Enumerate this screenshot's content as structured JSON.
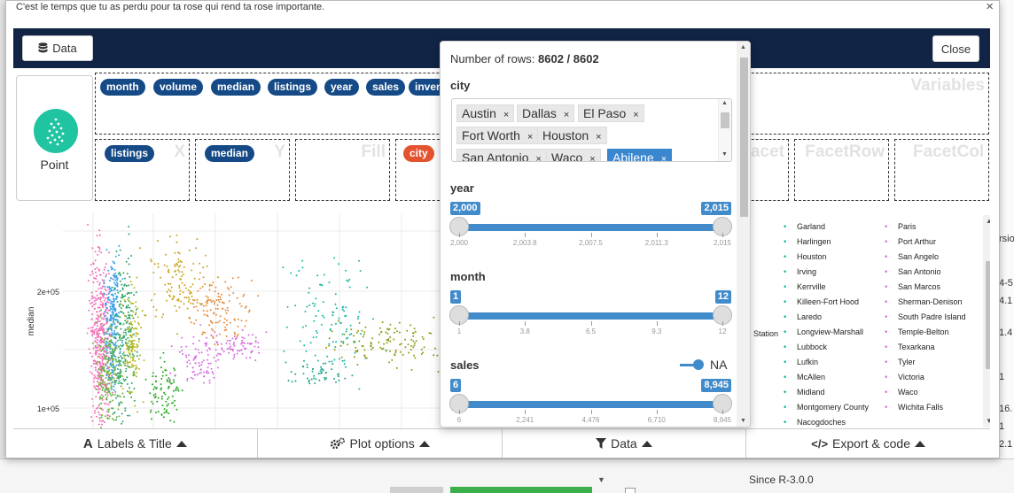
{
  "modal": {
    "title": "C'est le temps que tu as perdu pour ta rose qui rend ta rose importante.",
    "close_x": "×"
  },
  "topbar": {
    "data_label": "Data",
    "close_label": "Close"
  },
  "geom": {
    "label": "Point"
  },
  "variables": {
    "zone_label": "Variables",
    "pills": [
      "month",
      "volume",
      "median",
      "listings",
      "year",
      "sales",
      "inventory"
    ]
  },
  "mapping": {
    "x": {
      "label": "X",
      "pill": "listings"
    },
    "y": {
      "label": "Y",
      "pill": "median"
    },
    "fill": {
      "label": "Fill"
    },
    "color": {
      "pill": "city"
    },
    "facet": {
      "label": "Facet"
    },
    "facetrow": {
      "label": "FacetRow"
    },
    "facetcol": {
      "label": "FacetCol"
    }
  },
  "filter": {
    "rows_label": "Number of rows:",
    "rows_value": "8602 / 8602",
    "city_label": "city",
    "city_tags": [
      "Austin",
      "Dallas",
      "El Paso",
      "Fort Worth",
      "Houston",
      "San Antonio",
      "Waco",
      "Abilene"
    ],
    "year": {
      "label": "year",
      "min": 2000,
      "max": 2015,
      "from_label": "2,000",
      "to_label": "2,015",
      "grid": [
        "2,000",
        "2,003.8",
        "2,007.5",
        "2,011.3",
        "2,015"
      ]
    },
    "month": {
      "label": "month",
      "min": 1,
      "max": 12,
      "from_label": "1",
      "to_label": "12",
      "grid": [
        "1",
        "3.8",
        "6.5",
        "9.3",
        "12"
      ]
    },
    "sales": {
      "label": "sales",
      "min": 6,
      "max": 8945,
      "from_label": "6",
      "to_label": "8,945",
      "grid": [
        "6",
        "2,241",
        "4,476",
        "6,710",
        "8,945"
      ],
      "na_label": "NA"
    }
  },
  "plot": {
    "ylabel": "median",
    "y_ticks": [
      "2e+05",
      "1e+05"
    ],
    "legend_col1": [
      "Garland",
      "Harlingen",
      "Houston",
      "Irving",
      "Kerrville",
      "Killeen-Fort Hood",
      "Laredo",
      "Longview-Marshall",
      "Lubbock",
      "Lufkin",
      "McAllen",
      "Midland",
      "Montgomery County",
      "Nacogdoches"
    ],
    "legend_col2": [
      "Paris",
      "Port Arthur",
      "San Angelo",
      "San Antonio",
      "San Marcos",
      "Sherman-Denison",
      "South Padre Island",
      "Temple-Belton",
      "Texarkana",
      "Tyler",
      "Victoria",
      "Waco",
      "Wichita Falls"
    ],
    "legend_partial": "Station",
    "legend_col1_color": "#17b8a6",
    "legend_col2_color": "#e56bdd"
  },
  "bottom": {
    "labels": "Labels & Title",
    "plot_options": "Plot options",
    "data": "Data",
    "export": "Export & code"
  },
  "background": {
    "right_texts": [
      "rsio",
      "4-5",
      "4.1",
      "1.4",
      "1",
      "16.",
      "1",
      "2.1",
      "1.1"
    ],
    "since": "Since R-3.0.0"
  }
}
